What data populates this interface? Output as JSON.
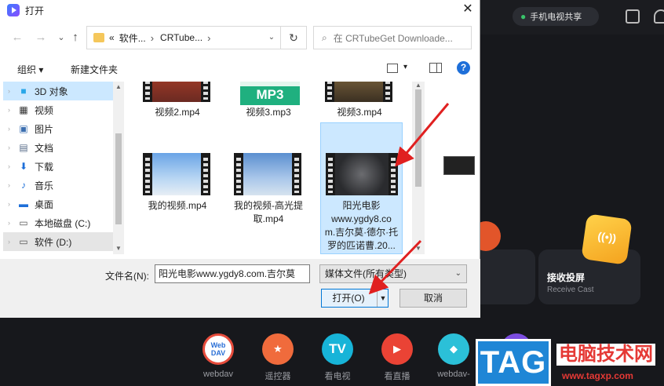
{
  "background_app": {
    "tv_share_label": "手机电视共享",
    "receive_cast": {
      "title": "接收投屏",
      "subtitle": "Receive Cast"
    },
    "bottom_bar": [
      {
        "label": "webdav",
        "icon_text": "Web DAV"
      },
      {
        "label": "遥控器",
        "icon_text": "★"
      },
      {
        "label": "看电视",
        "icon_text": "TV"
      },
      {
        "label": "看直播",
        "icon_text": "▶"
      },
      {
        "label": "webdav-",
        "icon_text": "◆"
      }
    ],
    "watermark": {
      "tag": "TAG",
      "site_cn": "电脑技术网",
      "url": "www.tagxp.com"
    }
  },
  "dialog": {
    "title": "打开",
    "close_glyph": "✕",
    "nav": {
      "back": "←",
      "forward": "→",
      "recent": "⌄",
      "up": "↑"
    },
    "address": {
      "overflow": "«",
      "crumbs": [
        "软件...",
        "CRTube..."
      ],
      "sep": "›",
      "dropdown": "⌄",
      "refresh": "↻"
    },
    "search_placeholder": "在 CRTubeGet Downloade...",
    "toolbar": {
      "organize": "组织 ▾",
      "new_folder": "新建文件夹",
      "view_dd": "▾",
      "help": "?"
    },
    "nav_pane": [
      {
        "label": "3D 对象",
        "icon": "cube-icon",
        "glyph": "■",
        "color": "#2aa7e8"
      },
      {
        "label": "视频",
        "icon": "video-folder-icon",
        "glyph": "▦",
        "color": "#333"
      },
      {
        "label": "图片",
        "icon": "image-folder-icon",
        "glyph": "▣",
        "color": "#3c6fb0"
      },
      {
        "label": "文档",
        "icon": "document-folder-icon",
        "glyph": "▤",
        "color": "#5a6e8a"
      },
      {
        "label": "下载",
        "icon": "download-icon",
        "glyph": "⬇",
        "color": "#1e6fd9"
      },
      {
        "label": "音乐",
        "icon": "music-icon",
        "glyph": "♪",
        "color": "#1e6fd9"
      },
      {
        "label": "桌面",
        "icon": "desktop-icon",
        "glyph": "▬",
        "color": "#1e6fd9"
      },
      {
        "label": "本地磁盘 (C:)",
        "icon": "drive-c-icon",
        "glyph": "▭",
        "color": "#555"
      },
      {
        "label": "软件 (D:)",
        "icon": "drive-d-icon",
        "glyph": "▭",
        "color": "#555"
      }
    ],
    "files": [
      {
        "name": "视频2.mp4"
      },
      {
        "name": "视频3.mp3",
        "badge": "MP3"
      },
      {
        "name": "视频3.mp4"
      },
      {
        "name": "我的视频.mp4"
      },
      {
        "name_lines": [
          "我的视频-高光提",
          "取.mp4"
        ]
      },
      {
        "name_lines": [
          "阳光电影",
          "www.ygdy8.co",
          "m.吉尔莫·德尔·托",
          "罗的匹诺曹.20..."
        ],
        "selected": true
      }
    ],
    "filename_label": "文件名(N):",
    "filename_value": "阳光电影www.ygdy8.com.吉尔莫",
    "filetype_value": "媒体文件(所有类型)",
    "open_button": "打开(O)",
    "cancel_button": "取消"
  }
}
